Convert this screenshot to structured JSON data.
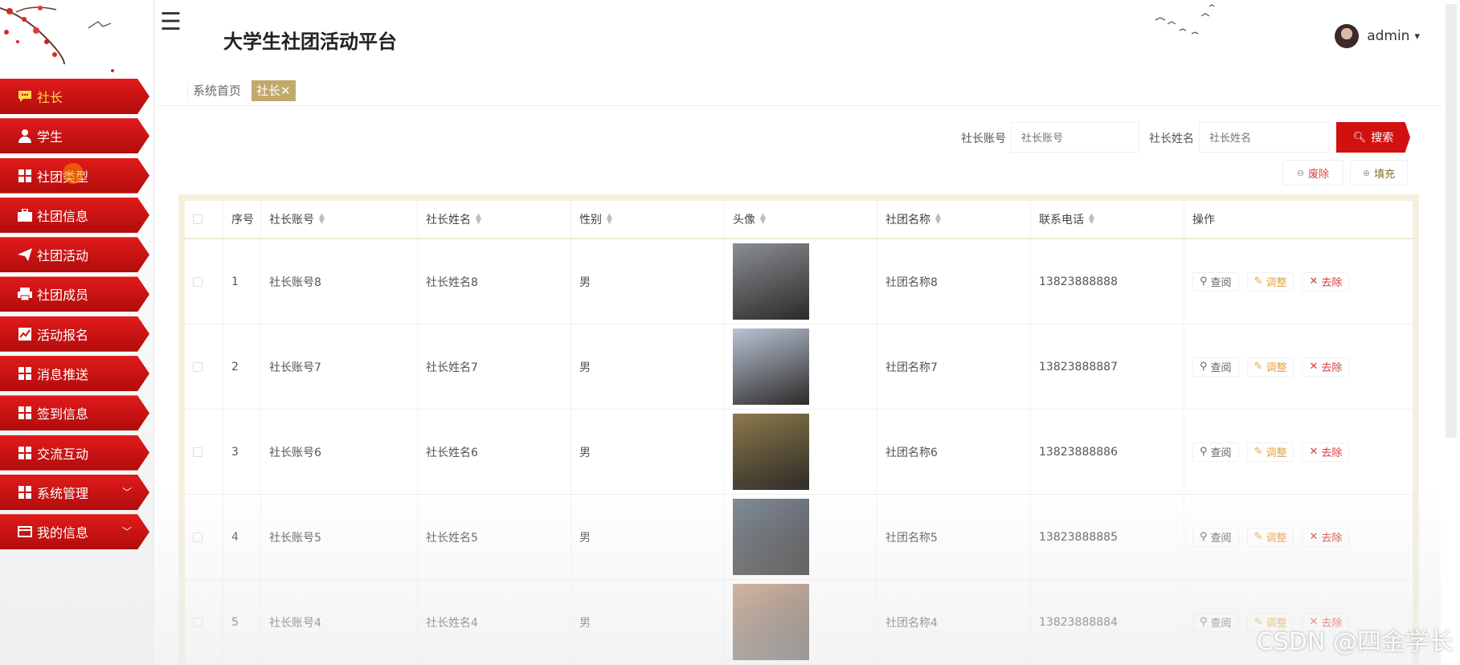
{
  "header": {
    "title": "大学生社团活动平台",
    "user": {
      "name": "admin",
      "caret": "▾"
    },
    "menu_icon": "hamburger-icon"
  },
  "sidebar": {
    "items": [
      {
        "label": "社长",
        "icon": "chat-icon",
        "active": true
      },
      {
        "label": "学生",
        "icon": "user-icon"
      },
      {
        "label": "社团类型",
        "icon": "grid-icon"
      },
      {
        "label": "社团信息",
        "icon": "briefcase-icon"
      },
      {
        "label": "社团活动",
        "icon": "send-icon"
      },
      {
        "label": "社团成员",
        "icon": "printer-icon"
      },
      {
        "label": "活动报名",
        "icon": "chart-icon"
      },
      {
        "label": "消息推送",
        "icon": "grid-icon"
      },
      {
        "label": "签到信息",
        "icon": "grid-icon"
      },
      {
        "label": "交流互动",
        "icon": "grid-icon"
      },
      {
        "label": "系统管理",
        "icon": "grid-icon",
        "expandable": true
      },
      {
        "label": "我的信息",
        "icon": "card-icon",
        "expandable": true
      }
    ]
  },
  "tabs": {
    "home": "系统首页",
    "active": "社长✕"
  },
  "search": {
    "account_label": "社长账号",
    "account_placeholder": "社长账号",
    "name_label": "社长姓名",
    "name_placeholder": "社长姓名",
    "button": "搜索"
  },
  "toolbar": {
    "delete": "废除",
    "add": "填充"
  },
  "table": {
    "columns": [
      "序号",
      "社长账号",
      "社长姓名",
      "性别",
      "头像",
      "社团名称",
      "联系电话",
      "操作"
    ],
    "rows": [
      {
        "no": "1",
        "account": "社长账号8",
        "name": "社长姓名8",
        "gender": "男",
        "club": "社团名称8",
        "phone": "13823888888",
        "photo_color": "#8a8e94"
      },
      {
        "no": "2",
        "account": "社长账号7",
        "name": "社长姓名7",
        "gender": "男",
        "club": "社团名称7",
        "phone": "13823888887",
        "photo_color": "#b9c4d6"
      },
      {
        "no": "3",
        "account": "社长账号6",
        "name": "社长姓名6",
        "gender": "男",
        "club": "社团名称6",
        "phone": "13823888886",
        "photo_color": "#8c7a4a"
      },
      {
        "no": "4",
        "account": "社长账号5",
        "name": "社长姓名5",
        "gender": "男",
        "club": "社团名称5",
        "phone": "13823888885",
        "photo_color": "#7b8794"
      },
      {
        "no": "5",
        "account": "社长账号4",
        "name": "社长姓名4",
        "gender": "男",
        "club": "社团名称4",
        "phone": "13823888884",
        "photo_color": "#c89a7a"
      }
    ],
    "actions": {
      "view": "查阅",
      "edit": "调整",
      "delete": "去除"
    }
  },
  "watermark": "CSDN @四金学长",
  "colors": {
    "primary": "#d31010",
    "accent": "#c1a96b"
  }
}
